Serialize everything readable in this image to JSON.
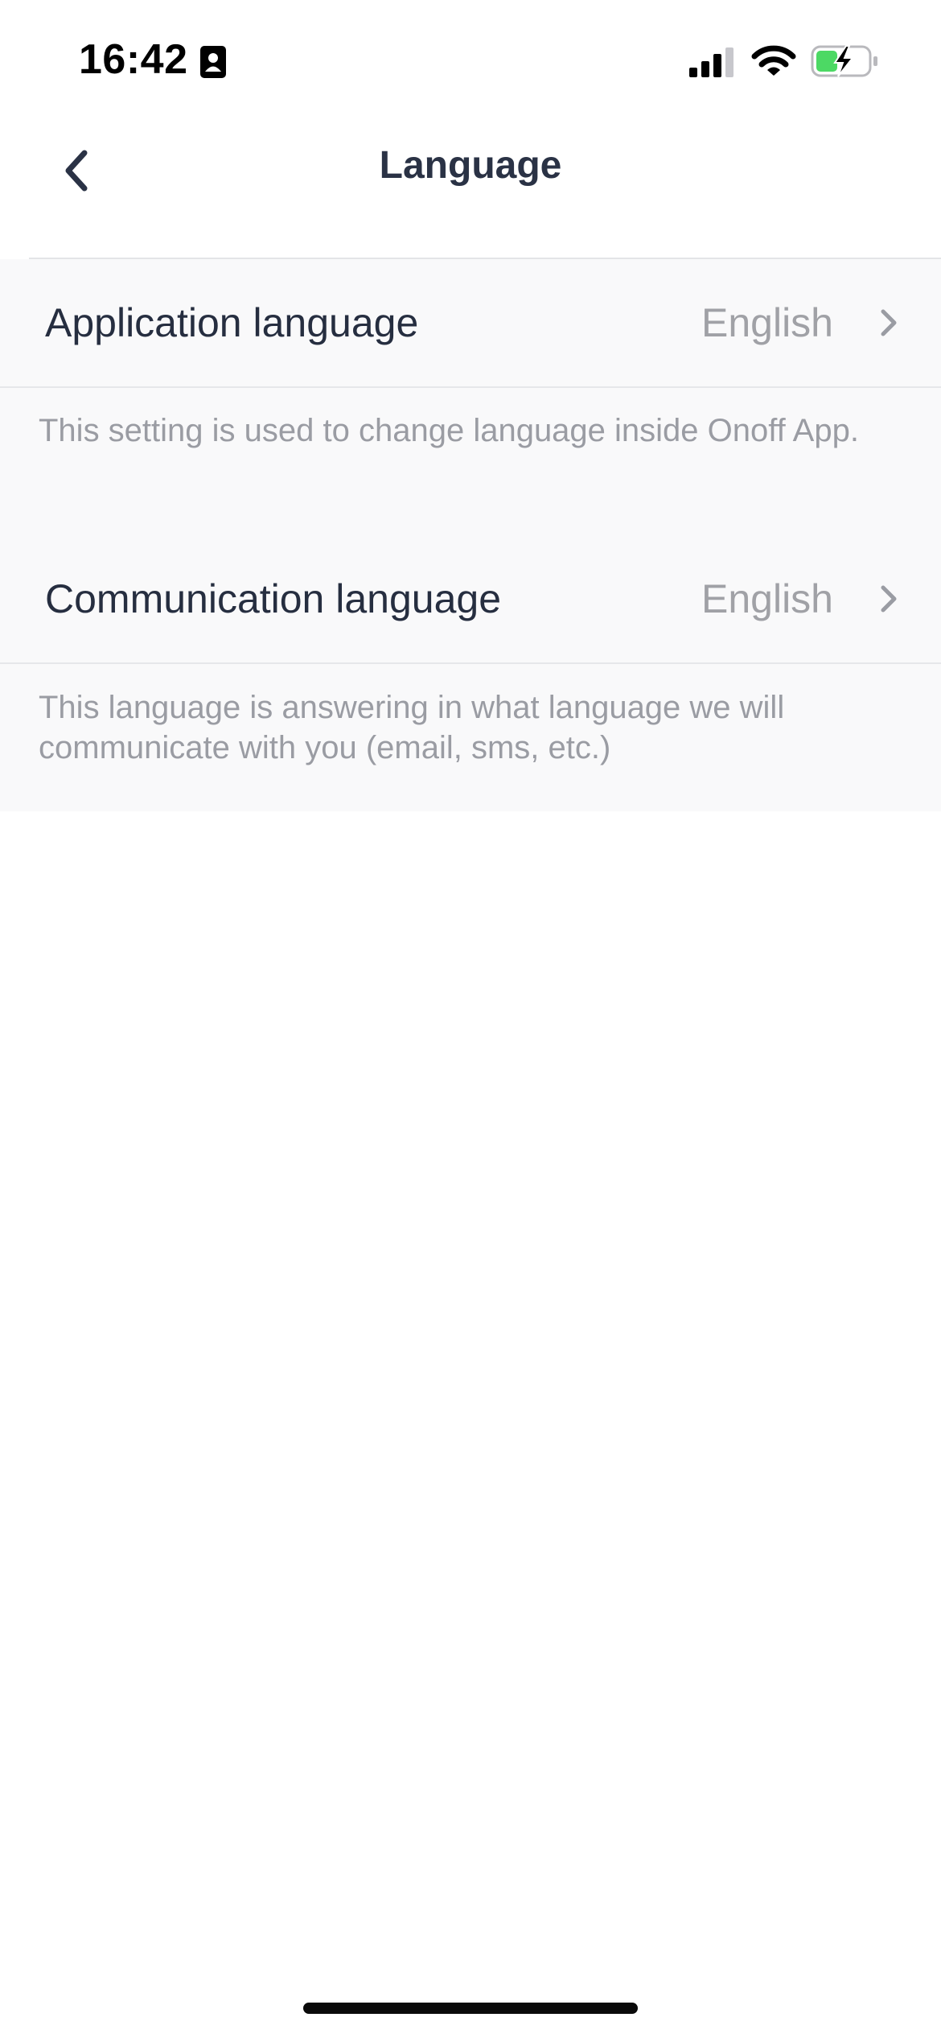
{
  "status_bar": {
    "time": "16:42"
  },
  "header": {
    "title": "Language"
  },
  "settings": [
    {
      "label": "Application language",
      "value": "English",
      "description": "This setting is used to change language inside Onoff App."
    },
    {
      "label": "Communication language",
      "value": "English",
      "description": "This language is answering in what language we will communicate with you (email, sms, etc.)"
    }
  ],
  "colors": {
    "title_text": "#2a3245",
    "label_text": "#262e40",
    "value_text": "#a0a1a6",
    "description_text": "#9a9ca3",
    "section_background": "#f9f9fa",
    "battery_fill": "#4cd964"
  }
}
